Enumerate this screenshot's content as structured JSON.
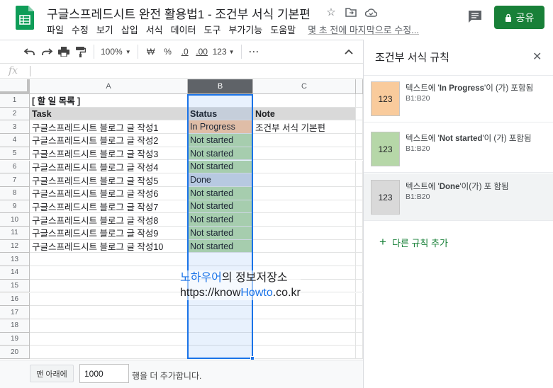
{
  "header": {
    "title": "구글스프레드시트 완전 활용법1 - 조건부 서식 기본편",
    "menu": [
      "파일",
      "수정",
      "보기",
      "삽입",
      "서식",
      "데이터",
      "도구",
      "부가기능",
      "도움말"
    ],
    "last_edit": "몇 초 전에 마지막으로 수정...",
    "share_label": "공유",
    "colors": {
      "share": "#188038",
      "logo": "#0f9d58"
    }
  },
  "toolbar": {
    "zoom": "100%",
    "currency": "₩",
    "percent": "%",
    "dec_less": ".0",
    "dec_more": ".00",
    "format": "123"
  },
  "formula_bar": {
    "label": "fx",
    "value": ""
  },
  "grid": {
    "columns": [
      "A",
      "B",
      "C"
    ],
    "rows": [
      [
        "1",
        "[ 할 일 목록 ]",
        "",
        ""
      ],
      [
        "2",
        "Task",
        "Status",
        "Note"
      ],
      [
        "3",
        "구글스프레드시트 블로그 글 작성1",
        "In Progress",
        "조건부 서식 기본편"
      ],
      [
        "4",
        "구글스프레드시트 블로그 글 작성2",
        "Not started",
        ""
      ],
      [
        "5",
        "구글스프레드시트 블로그 글 작성3",
        "Not started",
        ""
      ],
      [
        "6",
        "구글스프레드시트 블로그 글 작성4",
        "Not started",
        ""
      ],
      [
        "7",
        "구글스프레드시트 블로그 글 작성5",
        "Done",
        ""
      ],
      [
        "8",
        "구글스프레드시트 블로그 글 작성6",
        "Not started",
        ""
      ],
      [
        "9",
        "구글스프레드시트 블로그 글 작성7",
        "Not started",
        ""
      ],
      [
        "10",
        "구글스프레드시트 블로그 글 작성8",
        "Not started",
        ""
      ],
      [
        "11",
        "구글스프레드시트 블로그 글 작성9",
        "Not started",
        ""
      ],
      [
        "12",
        "구글스프레드시트 블로그 글 작성10",
        "Not started",
        ""
      ],
      [
        "13",
        "",
        "",
        ""
      ],
      [
        "14",
        "",
        "",
        ""
      ],
      [
        "15",
        "",
        "",
        ""
      ],
      [
        "16",
        "",
        "",
        ""
      ],
      [
        "17",
        "",
        "",
        ""
      ],
      [
        "18",
        "",
        "",
        ""
      ],
      [
        "19",
        "",
        "",
        ""
      ],
      [
        "20",
        "",
        "",
        ""
      ]
    ],
    "status_colors": {
      "In Progress": "#f5c6a0",
      "Not started": "#b6d7a8",
      "Done": "#c9d3e0"
    }
  },
  "watermark": {
    "name_blue": "노하우어",
    "name_rest": "의 정보저장소",
    "url_pre": "https://know",
    "url_blue": "Howto",
    "url_post": ".co.kr"
  },
  "bottom": {
    "add_button": "맨 아래에",
    "add_count": "1000",
    "add_text": "행을 더 추가합니다."
  },
  "panel": {
    "title": "조건부 서식 규칙",
    "rules": [
      {
        "swatch": "123",
        "color": "#f9cb9c",
        "pre": "텍스트에 '",
        "bold": "In Progress",
        "post": "'이 (가) 포함됨",
        "range": "B1:B20"
      },
      {
        "swatch": "123",
        "color": "#b6d7a8",
        "pre": "텍스트에 '",
        "bold": "Not started",
        "post": "'이 (가) 포함됨",
        "range": "B1:B20"
      },
      {
        "swatch": "123",
        "color": "#d9d9d9",
        "pre": "텍스트에 '",
        "bold": "Done",
        "post": "'이(가) 포 함됨",
        "range": "B1:B20"
      }
    ],
    "add_rule": "다른 규칙 추가"
  }
}
